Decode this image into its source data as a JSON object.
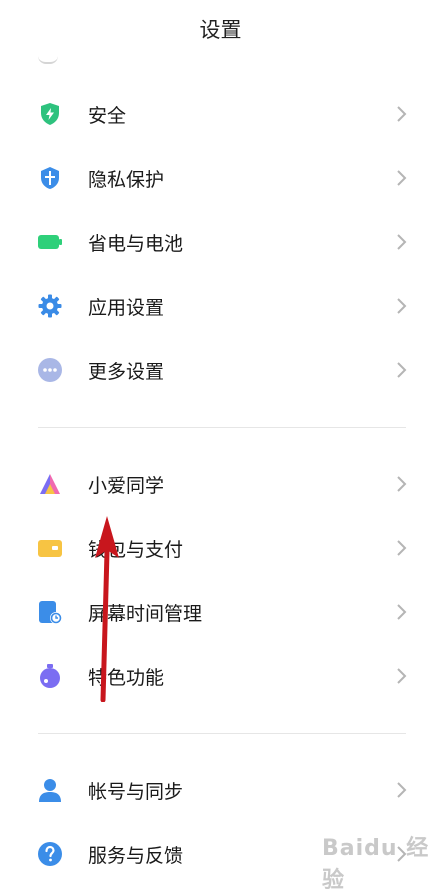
{
  "header": {
    "title": "设置"
  },
  "group1": [
    {
      "label": "安全",
      "icon": "shield-bolt-icon",
      "color": "#2ec27e"
    },
    {
      "label": "隐私保护",
      "icon": "privacy-shield-icon",
      "color": "#3b8de8"
    },
    {
      "label": "省电与电池",
      "icon": "battery-icon",
      "color": "#2fd07a"
    },
    {
      "label": "应用设置",
      "icon": "gear-icon",
      "color": "#3a8be6"
    },
    {
      "label": "更多设置",
      "icon": "more-dots-icon",
      "color": "#a9b7e6"
    }
  ],
  "group2": [
    {
      "label": "小爱同学",
      "icon": "xiaoai-icon",
      "color": "#6a6ff0"
    },
    {
      "label": "钱包与支付",
      "icon": "wallet-icon",
      "color": "#f7c443"
    },
    {
      "label": "屏幕时间管理",
      "icon": "screen-time-icon",
      "color": "#3b8de8"
    },
    {
      "label": "特色功能",
      "icon": "special-features-icon",
      "color": "#7b6df2"
    }
  ],
  "group3": [
    {
      "label": "帐号与同步",
      "icon": "account-icon",
      "color": "#3b8de8"
    },
    {
      "label": "服务与反馈",
      "icon": "help-icon",
      "color": "#3b8de8"
    }
  ],
  "watermark": "Baidu 经验"
}
